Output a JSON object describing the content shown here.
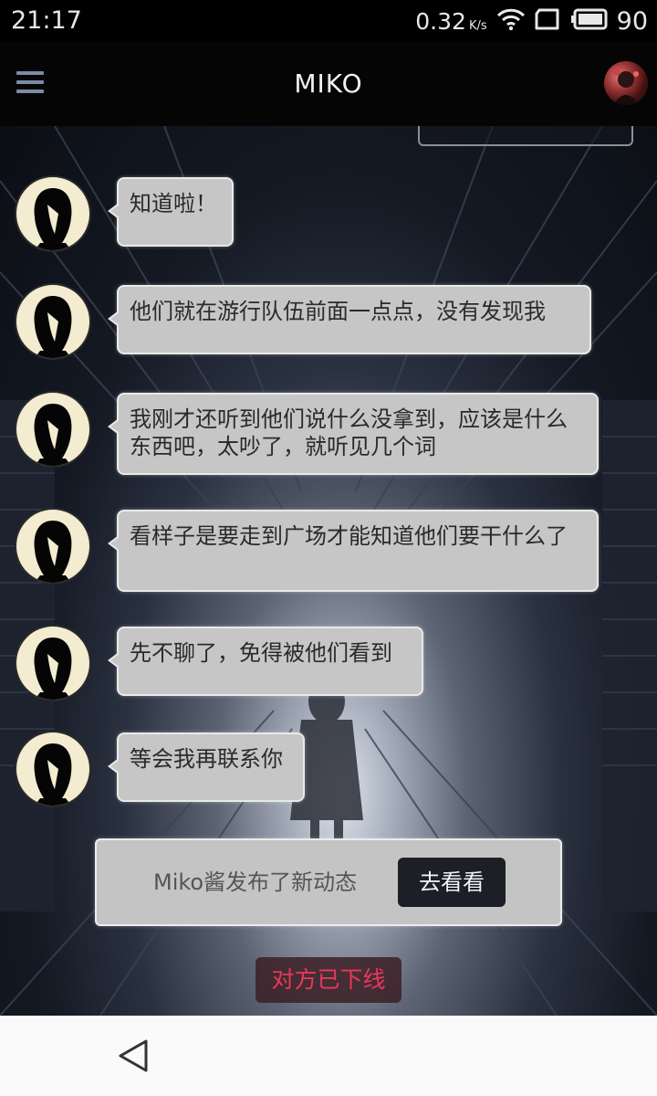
{
  "status_bar": {
    "time": "21:17",
    "net_speed": "0.32",
    "net_unit": "K/s",
    "battery": "90",
    "icons": [
      "wifi-icon",
      "sim-icon",
      "battery-icon"
    ]
  },
  "header": {
    "title": "MIKO",
    "menu_icon": "menu-icon",
    "avatar": "contact-avatar"
  },
  "messages": [
    {
      "text": "知道啦！"
    },
    {
      "text": "他们就在游行队伍前面一点点，没有发现我"
    },
    {
      "text": "我刚才还听到他们说什么没拿到，应该是什么东西吧，太吵了，就听见几个词"
    },
    {
      "text": "看样子是要走到广场才能知道他们要干什么了"
    },
    {
      "text": "先不聊了，免得被他们看到"
    },
    {
      "text": "等会我再联系你"
    }
  ],
  "notice": {
    "text": "Miko酱发布了新动态",
    "button_label": "去看看"
  },
  "offline_status": "对方已下线",
  "colors": {
    "offline_text": "#e8385a",
    "bubble_bg": "#c6c6c6",
    "header_bg": "#050505",
    "button_bg": "#1c1f26"
  }
}
